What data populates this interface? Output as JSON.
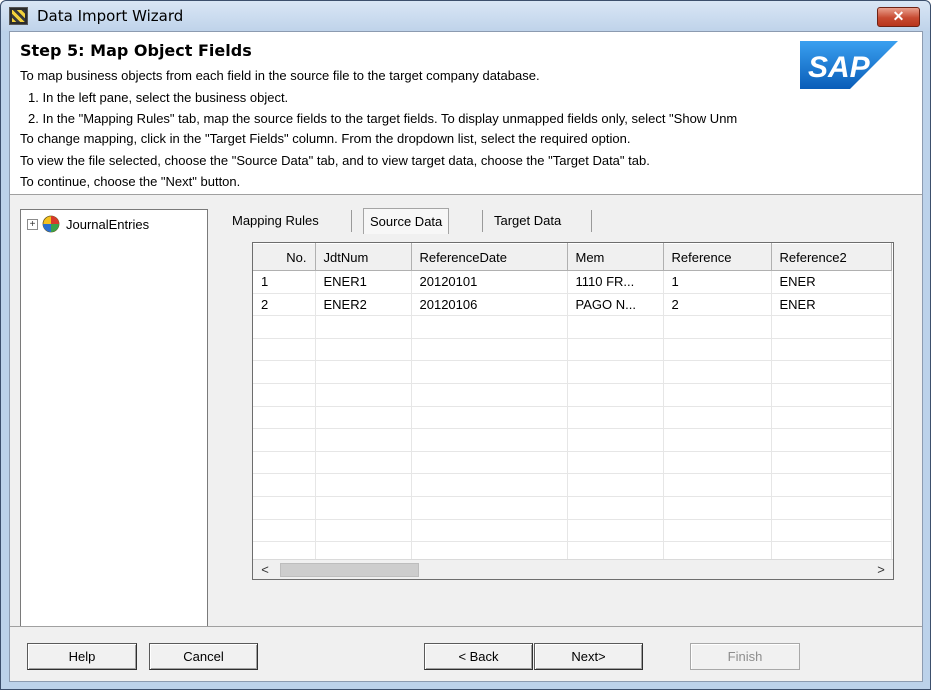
{
  "window": {
    "title": "Data Import Wizard",
    "close_glyph": "✕"
  },
  "header": {
    "step_title": "Step 5: Map Object Fields",
    "lines": [
      "To map business objects from each field in the source file to the target company database.",
      "1. In the left pane, select the business object.",
      "2. In the \"Mapping Rules\" tab, map the source fields to the target fields. To display unmapped fields only, select \"Show Unm",
      "To change mapping, click in the \"Target Fields\" column. From the dropdown list, select the required option.",
      "To view the file selected, choose the \"Source Data\" tab, and to view target data, choose the \"Target Data\" tab.",
      "To continue, choose the \"Next\" button."
    ],
    "logo_text": "SAP"
  },
  "tree": {
    "expander": "+",
    "item_label": "JournalEntries"
  },
  "tabs": [
    {
      "label": "Mapping Rules",
      "active": false
    },
    {
      "label": "Source Data",
      "active": true
    },
    {
      "label": "Target Data",
      "active": false
    }
  ],
  "grid": {
    "columns": [
      "No.",
      "JdtNum",
      "ReferenceDate",
      "Mem",
      "Reference",
      "Reference2"
    ],
    "rows": [
      [
        "1",
        "ENER1",
        "20120101",
        "1110 FR...",
        "1",
        "ENER"
      ],
      [
        "2",
        "ENER2",
        "20120106",
        "PAGO N...",
        "2",
        "ENER"
      ]
    ],
    "scroll_left": "<",
    "scroll_right": ">"
  },
  "buttons": {
    "help": "Help",
    "cancel": "Cancel",
    "back": "< Back",
    "next": "Next>",
    "finish": "Finish"
  },
  "colors": {
    "titlebar": "#bfd3ea",
    "close_button": "#c74a31",
    "sap_blue": "#0a6ed1"
  }
}
